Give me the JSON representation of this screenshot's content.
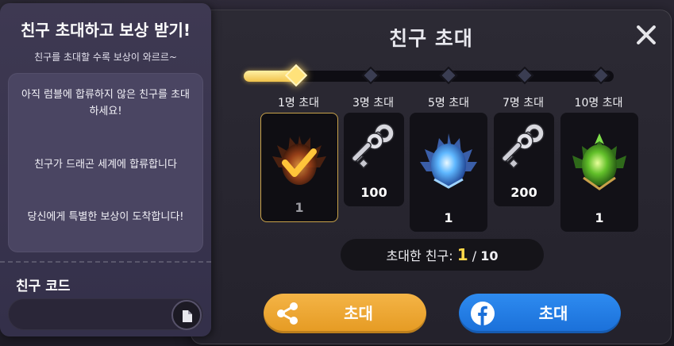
{
  "side_panel": {
    "title": "친구 초대하고 보상 받기!",
    "subtitle": "친구를 초대할 수록 보상이 와르르~",
    "steps": [
      "아직 럼블에 합류하지 않은 친구를 초대하세요!",
      "친구가 드래곤 세계에 합류합니다",
      "당신에게 특별한 보상이 도착합니다!"
    ],
    "code_label": "친구 코드",
    "code_value": "",
    "copy_icon": "copy-icon"
  },
  "panel": {
    "title": "친구 초대",
    "close_icon": "close-icon",
    "progress": {
      "current": 1,
      "max": 10,
      "fill_color": "#f0c24a"
    },
    "tiers": [
      {
        "label": "1명 초대",
        "reward": "dragon-egg-fire",
        "qty": "1",
        "claimed": true
      },
      {
        "label": "3명 초대",
        "reward": "silver-key",
        "qty": "100",
        "claimed": false
      },
      {
        "label": "5명 초대",
        "reward": "dragon-egg-ice",
        "qty": "1",
        "claimed": false
      },
      {
        "label": "7명 초대",
        "reward": "silver-key",
        "qty": "200",
        "claimed": false
      },
      {
        "label": "10명 초대",
        "reward": "dragon-egg-nature",
        "qty": "1",
        "claimed": false
      }
    ],
    "invited": {
      "label": "초대한 친구:",
      "current": "1",
      "separator": " / ",
      "max": "10"
    },
    "share_button": {
      "label": "초대",
      "icon": "share-icon",
      "color": "#f4b446"
    },
    "facebook_button": {
      "label": "초대",
      "icon": "facebook-icon",
      "color": "#2e8bf0"
    }
  }
}
